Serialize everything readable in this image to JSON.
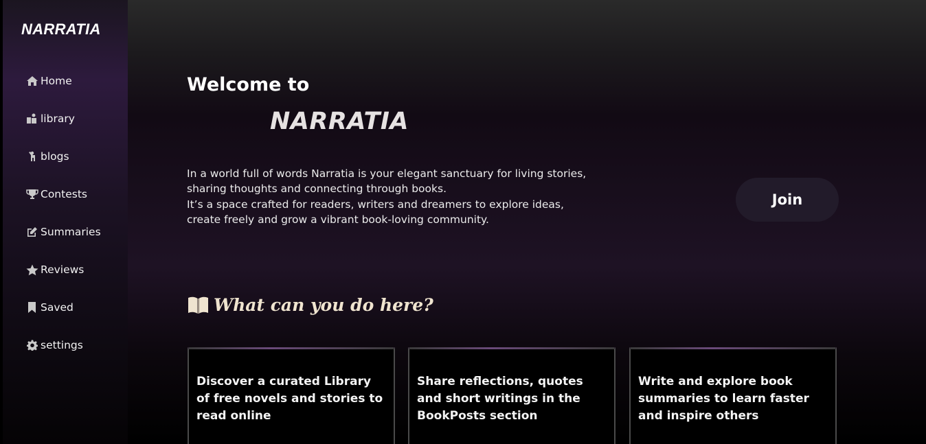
{
  "sidebar": {
    "brand": "NARRATIA",
    "items": [
      {
        "label": "Home",
        "icon": "home-icon"
      },
      {
        "label": "library",
        "icon": "library-icon"
      },
      {
        "label": "blogs",
        "icon": "blog-icon"
      },
      {
        "label": "Contests",
        "icon": "trophy-icon"
      },
      {
        "label": "Summaries",
        "icon": "edit-icon"
      },
      {
        "label": "Reviews",
        "icon": "star-icon"
      },
      {
        "label": "Saved",
        "icon": "bookmark-icon"
      },
      {
        "label": "settings",
        "icon": "gear-icon"
      }
    ]
  },
  "hero": {
    "welcome": "Welcome to",
    "title": "NARRATIA",
    "intro_lines": [
      "In a world full of words Narratia is your elegant sanctuary for living stories,",
      "sharing thoughts and connecting through books.",
      "It’s a space crafted for readers, writers and dreamers to explore ideas,",
      "create freely and grow a vibrant book-loving community."
    ],
    "join_label": "Join"
  },
  "features": {
    "title": "What can you do here?",
    "icon": "open-book-icon",
    "cards": [
      {
        "text": "Discover a curated Library of free novels and stories to read online"
      },
      {
        "text": "Share reflections, quotes and short writings in the BookPosts section"
      },
      {
        "text": "Write and explore book summaries to learn faster and inspire others"
      }
    ]
  },
  "colors": {
    "accent_purple": "#2d1a3d",
    "join_button": "#221b2a",
    "section_title": "#efe4cf"
  }
}
